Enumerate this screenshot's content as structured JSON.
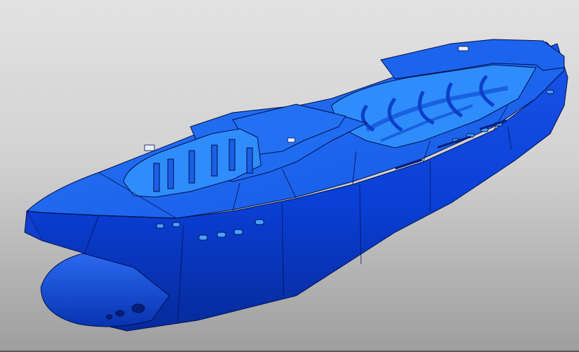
{
  "viewport": {
    "background_top": "#e2e2e2",
    "background_bottom": "#9e9e9e"
  },
  "model": {
    "icon": "ship-hull-model",
    "hull_color": "#0a3fd6",
    "hull_shadow": "#062a9a",
    "deck_color": "#1f6cf0",
    "interior_color": "#2f8dfb",
    "edge_color": "#00114f"
  }
}
